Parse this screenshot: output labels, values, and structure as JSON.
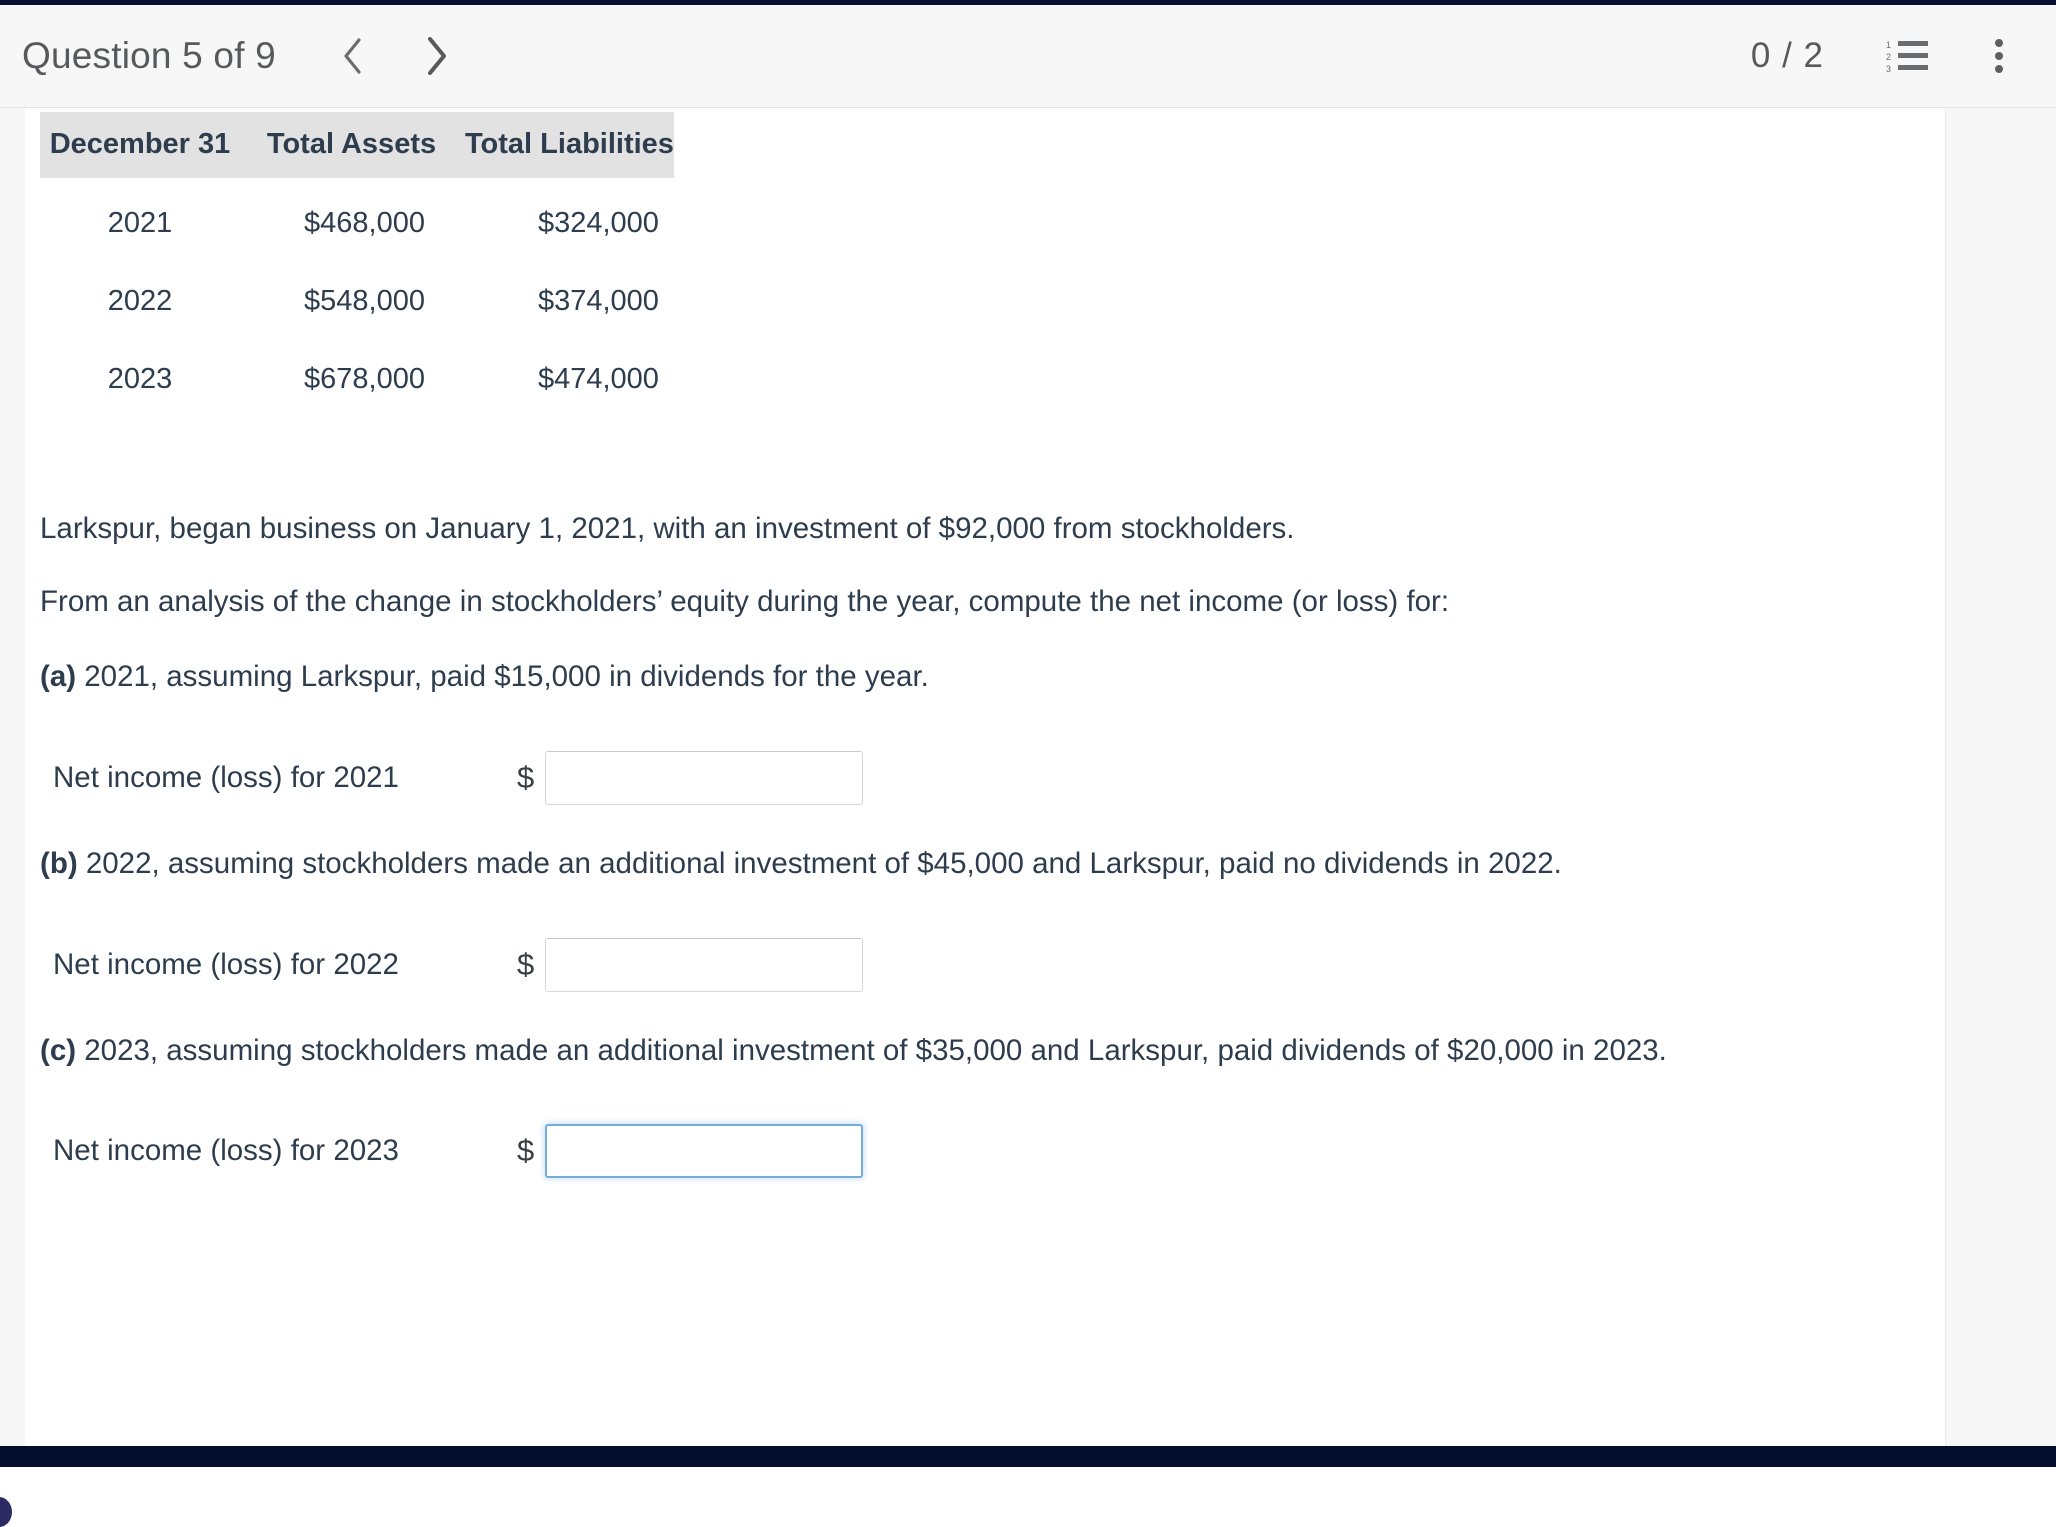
{
  "header": {
    "question_title": "Question 5 of 9",
    "prev_label": "Previous question",
    "next_label": "Next question",
    "score": "0 / 2",
    "list_icon": "numbered-list-icon",
    "menu_icon": "more-vertical-icon"
  },
  "table": {
    "columns": [
      "December 31",
      "Total Assets",
      "Total Liabilities"
    ],
    "rows": [
      {
        "date": "2021",
        "assets": "$468,000",
        "liabilities": "$324,000"
      },
      {
        "date": "2022",
        "assets": "$548,000",
        "liabilities": "$374,000"
      },
      {
        "date": "2023",
        "assets": "$678,000",
        "liabilities": "$474,000"
      }
    ]
  },
  "body": {
    "intro": "Larkspur, began business on January 1, 2021, with an investment of $92,000 from stockholders.",
    "compute": "From an analysis of the change in stockholders’ equity during the year, compute the net income (or loss) for:"
  },
  "parts": [
    {
      "marker": "(a)",
      "text": " 2021, assuming Larkspur, paid $15,000 in dividends for the year.",
      "answer_label": "Net income (loss) for 2021",
      "currency": "$",
      "value": "",
      "placeholder": ""
    },
    {
      "marker": "(b)",
      "text": " 2022, assuming stockholders made an additional investment of $45,000 and Larkspur, paid no dividends in 2022.",
      "answer_label": "Net income (loss) for 2022",
      "currency": "$",
      "value": "",
      "placeholder": ""
    },
    {
      "marker": "(c)",
      "text": " 2023, assuming stockholders made an additional investment of $35,000 and Larkspur, paid dividends of $20,000 in 2023.",
      "answer_label": "Net income (loss) for 2023",
      "currency": "$",
      "value": "",
      "placeholder": ""
    }
  ],
  "colors": {
    "text": "#2e3d4e",
    "header_bg": "#f7f7f7",
    "table_header_bg": "#e2e2e2",
    "focus_border": "#75acdf",
    "bottom_bar": "#040c2e"
  }
}
